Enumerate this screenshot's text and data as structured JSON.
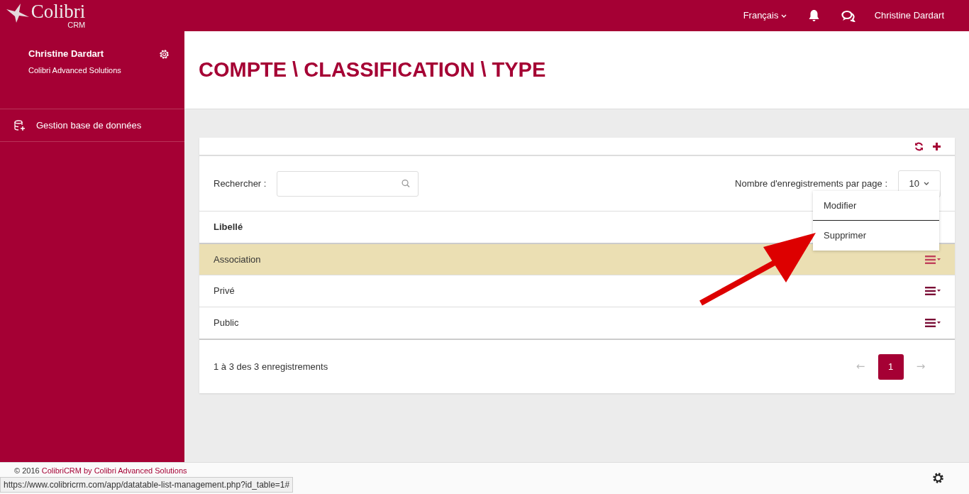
{
  "topbar": {
    "logo": {
      "name": "Colibri",
      "sub": "CRM"
    },
    "language": "Français",
    "user": "Christine Dardart"
  },
  "sidebar": {
    "profile": {
      "name": "Christine Dardart",
      "company": "Colibri Advanced Solutions"
    },
    "items": [
      {
        "label": "Gestion base de données",
        "selected": false
      }
    ]
  },
  "page": {
    "title": "COMPTE \\ CLASSIFICATION \\ TYPE"
  },
  "table": {
    "search_label": "Rechercher :",
    "page_size_label": "Nombre d'enregistrements par page :",
    "page_size": "10",
    "columns": [
      "Libellé"
    ],
    "rows": [
      {
        "label": "Association",
        "selected": true
      },
      {
        "label": "Privé",
        "selected": false
      },
      {
        "label": "Public",
        "selected": false
      }
    ],
    "info": "1 à 3 des 3 enregistrements",
    "pagination": [
      {
        "label": "←",
        "kind": "prev",
        "disabled": true,
        "selected": false
      },
      {
        "label": "1",
        "kind": "page",
        "disabled": false,
        "selected": true
      },
      {
        "label": "→",
        "kind": "next",
        "disabled": true,
        "selected": false
      }
    ]
  },
  "row_menu": {
    "items": [
      "Modifier",
      "Supprimer"
    ]
  },
  "footer": {
    "year": "© 2016",
    "link": "ColibriCRM by Colibri Advanced Solutions"
  },
  "status_url": "https://www.colibricrm.com/app/datatable-list-management.php?id_table=1#"
}
